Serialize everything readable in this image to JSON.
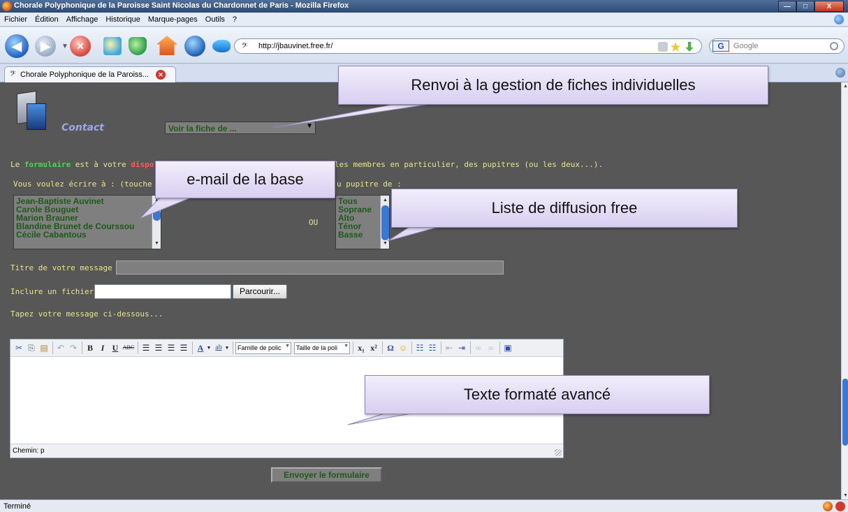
{
  "window": {
    "title": "Chorale Polyphonique de la Paroisse Saint Nicolas du Chardonnet de Paris - Mozilla Firefox",
    "buttons": [
      "—",
      "□",
      "X"
    ]
  },
  "menu": [
    "Fichier",
    "Édition",
    "Affichage",
    "Historique",
    "Marque-pages",
    "Outils",
    "?"
  ],
  "navbar": {
    "url": "http://jbauvinet.free.fr/",
    "search_placeholder": "Google",
    "search_engine": "G"
  },
  "tab": {
    "title": "Chorale Polyphonique de la Paroiss..."
  },
  "page": {
    "contact_label": "Contact",
    "fiche_select": "Voir la fiche de ...",
    "intro": {
      "le": "Le ",
      "formulaire": "formulaire",
      "est": " est à votre ",
      "dispo": "dispo",
      "tail": "les membres en particulier, des pupitres (ou les deux...)."
    },
    "write_label": "Vous voulez écrire à : (touche C",
    "pupitre_label": "u pupitre de :",
    "members": [
      "Jean-Baptiste Auvinet",
      "Carole Bouguet",
      "Marion Brauner",
      "Blandine Brunet de Courssou",
      "Cécile Cabantous"
    ],
    "pupitres": [
      "Tous",
      "Soprane",
      "Alto",
      "Ténor",
      "Basse"
    ],
    "ou": "OU",
    "titre_label": "Titre de votre message",
    "fichier_label": "Inclure un fichier :",
    "browse": "Parcourir...",
    "tapez_label": "Tapez votre message ci-dessous...",
    "editor": {
      "font_family": "Famille de polic",
      "font_size": "Taille de la poli",
      "status": "Chemin: p"
    },
    "submit": "Envoyer le formulaire"
  },
  "callouts": {
    "fiches": "Renvoi à la gestion de fiches individuelles",
    "email": "e-mail de la base",
    "diffusion": "Liste de diffusion free",
    "texte": "Texte formaté avancé"
  },
  "status": "Terminé"
}
